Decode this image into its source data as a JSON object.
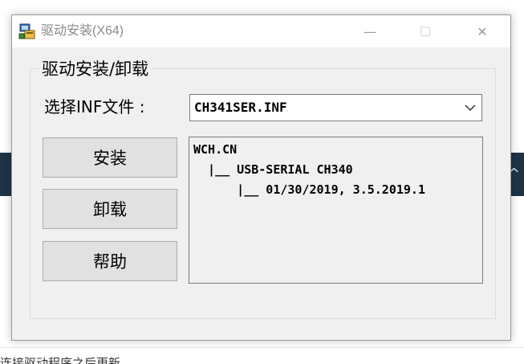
{
  "window": {
    "title": "驱动安装(X64)",
    "minimize_glyph": "—",
    "maximize_glyph": "☐",
    "close_glyph": "✕"
  },
  "group": {
    "title": "驱动安装/卸载"
  },
  "inf": {
    "label": "选择INF文件 :",
    "selected": "CH341SER.INF"
  },
  "buttons": {
    "install": "安装",
    "uninstall": "卸载",
    "help": "帮助"
  },
  "info": {
    "lines": [
      "WCH.CN",
      "  |__ USB-SERIAL CH340",
      "      |__ 01/30/2019, 3.5.2019.1"
    ]
  },
  "background": {
    "chevron": "^",
    "bottom_text": "连接驱动程序之后更新"
  },
  "colors": {
    "window_bg": "#f0f0f0",
    "titlebar_bg": "#ffffff",
    "background_strip": "#1e3446"
  }
}
